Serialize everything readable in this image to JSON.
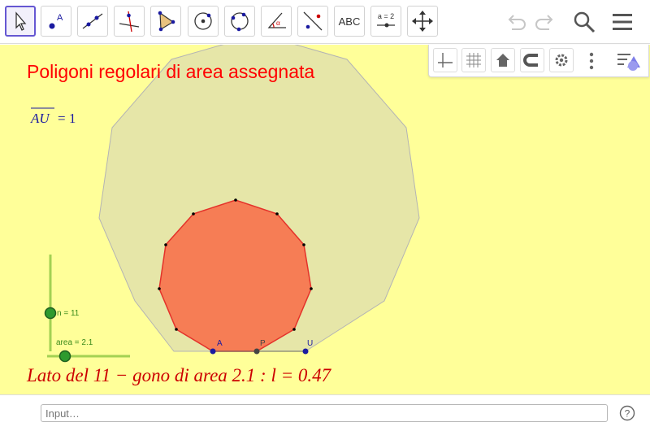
{
  "toolbar": {
    "tools": [
      {
        "name": "move-tool",
        "label": ""
      },
      {
        "name": "point-tool",
        "label": "A"
      },
      {
        "name": "line-tool",
        "label": ""
      },
      {
        "name": "perpendicular-line-tool",
        "label": ""
      },
      {
        "name": "polygon-tool",
        "label": ""
      },
      {
        "name": "circle-center-point-tool",
        "label": ""
      },
      {
        "name": "circle-three-points-tool",
        "label": ""
      },
      {
        "name": "angle-tool",
        "label": "α"
      },
      {
        "name": "reflect-tool",
        "label": ""
      },
      {
        "name": "text-tool",
        "label": "ABC"
      },
      {
        "name": "slider-tool",
        "label": "a = 2"
      },
      {
        "name": "move-graphics-view-tool",
        "label": ""
      }
    ],
    "right_icons": [
      "undo-icon",
      "redo-icon",
      "search-icon",
      "menu-icon"
    ]
  },
  "graphics": {
    "title": "Poligoni regolari di area assegnata",
    "length_label": "AU",
    "length_value": "= 1",
    "slider_n": {
      "label": "n = 11",
      "value": 11
    },
    "slider_area": {
      "label": "area = 2.1",
      "value": 2.1
    },
    "points": {
      "A": "A",
      "P": "P",
      "U": "U"
    },
    "result_text": "Lato del 11 − gono di area 2.1 :  l = 0.47",
    "colors": {
      "background": "#ffff99",
      "big_polygon_fill": "#e6e6a8",
      "small_polygon_fill": "#f67d55",
      "small_polygon_stroke": "#e4322a",
      "title": "#ff0000",
      "slider": "#a3d153",
      "point": "#1a1aa0"
    }
  },
  "stylebar": {
    "buttons": [
      "axes-icon",
      "grid-icon",
      "home-icon",
      "snap-icon",
      "settings-icon",
      "more-options-icon",
      "view-toggle-icon"
    ]
  },
  "input_bar": {
    "placeholder": "Input…"
  }
}
